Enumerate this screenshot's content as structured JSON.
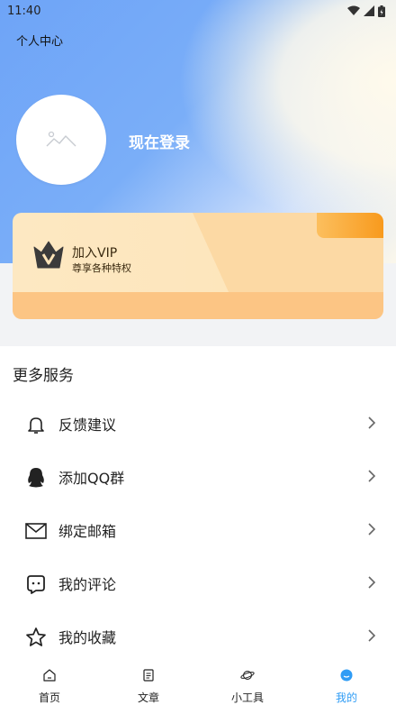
{
  "status_bar": {
    "time": "11:40"
  },
  "header": {
    "title": "个人中心"
  },
  "profile": {
    "login_label": "现在登录"
  },
  "vip": {
    "title": "加入VIP",
    "subtitle": "尊享各种特权"
  },
  "services": {
    "title": "更多服务",
    "items": [
      {
        "label": "反馈建议",
        "icon": "bell-icon"
      },
      {
        "label": "添加QQ群",
        "icon": "qq-icon"
      },
      {
        "label": "绑定邮箱",
        "icon": "mail-icon"
      },
      {
        "label": "我的评论",
        "icon": "comment-icon"
      },
      {
        "label": "我的收藏",
        "icon": "star-icon"
      }
    ]
  },
  "tabbar": {
    "items": [
      {
        "label": "首页",
        "icon": "home-icon"
      },
      {
        "label": "文章",
        "icon": "article-icon"
      },
      {
        "label": "小工具",
        "icon": "planet-icon"
      },
      {
        "label": "我的",
        "icon": "profile-icon",
        "active": true
      }
    ]
  },
  "colors": {
    "accent": "#2f9cf5",
    "hero_blue": "#6ea4f7",
    "vip_orange": "#f89a1d"
  }
}
